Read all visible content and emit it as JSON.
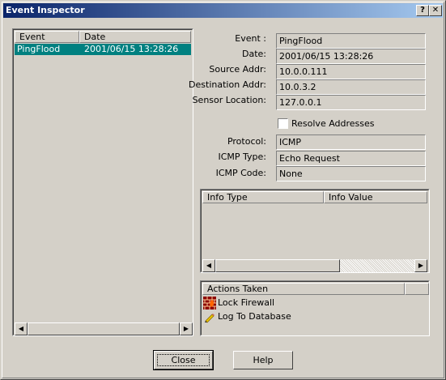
{
  "window": {
    "title": "Event Inspector",
    "help_button": "?",
    "close_button": "✕"
  },
  "events_list": {
    "columns": [
      "Event",
      "Date"
    ],
    "rows": [
      {
        "event": "PingFlood",
        "date": "2001/06/15 13:28:26",
        "selected": true
      }
    ]
  },
  "details": {
    "event_label": "Event :",
    "event_value": "PingFlood",
    "date_label": "Date:",
    "date_value": "2001/06/15 13:28:26",
    "source_label": "Source Addr:",
    "source_value": "10.0.0.111",
    "destination_label": "Destination Addr:",
    "destination_value": "10.0.3.2",
    "sensor_label": "Sensor Location:",
    "sensor_value": "127.0.0.1",
    "resolve_label": "Resolve Addresses",
    "resolve_checked": false,
    "protocol_label": "Protocol:",
    "protocol_value": "ICMP",
    "icmp_type_label": "ICMP Type:",
    "icmp_type_value": "Echo Request",
    "icmp_code_label": "ICMP Code:",
    "icmp_code_value": "None"
  },
  "info_table": {
    "columns": [
      "Info Type",
      "Info Value"
    ],
    "rows": []
  },
  "actions": {
    "header": "Actions Taken",
    "items": [
      {
        "label": "Lock Firewall",
        "icon": "firewall-icon"
      },
      {
        "label": "Log To Database",
        "icon": "pencil-icon"
      }
    ]
  },
  "buttons": {
    "close": "Close",
    "help": "Help"
  },
  "colors": {
    "selection": "#008080",
    "title_start": "#0a246a",
    "title_end": "#a6caf0"
  }
}
